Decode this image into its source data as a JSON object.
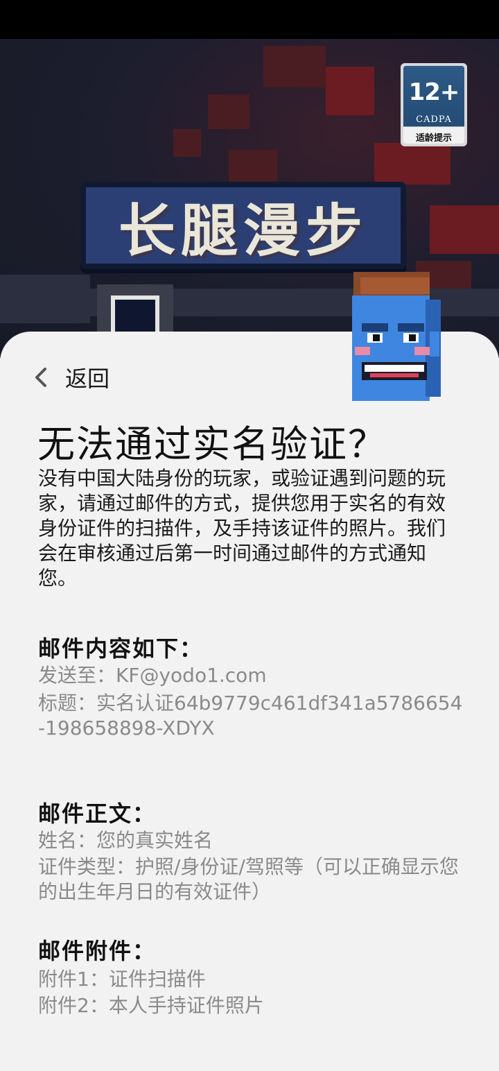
{
  "header": {
    "back_label": "返回",
    "age_rating": {
      "number": "12+",
      "org": "CADPA",
      "tip": "适龄提示"
    },
    "game_logo_text": "长腿漫步"
  },
  "title": "无法通过实名验证？",
  "intro": "没有中国大陆身份的玩家，或验证遇到问题的玩家，请通过邮件的方式，提供您用于实名的有效身份证件的扫描件，及手持该证件的照片。我们会在审核通过后第一时间通过邮件的方式通知您。",
  "email_content": {
    "heading": "邮件内容如下：",
    "send_to": "发送至：KF@yodo1.com",
    "subject": "标题：实名认证64b9779c461df341a5786654-198658898-XDYX"
  },
  "email_body": {
    "heading": "邮件正文：",
    "name": "姓名：您的真实姓名",
    "id_type": "证件类型：护照/身份证/驾照等（可以正确显示您的出生年月日的有效证件）"
  },
  "email_attachments": {
    "heading": "邮件附件：",
    "attachment_1": "附件1：证件扫描件",
    "attachment_2": "附件2：本人手持证件照片"
  },
  "colors": {
    "sheet_background": "#f2f2f2",
    "primary_text": "#111111",
    "secondary_text": "#8a8a8a",
    "status_bar": "#000000"
  }
}
